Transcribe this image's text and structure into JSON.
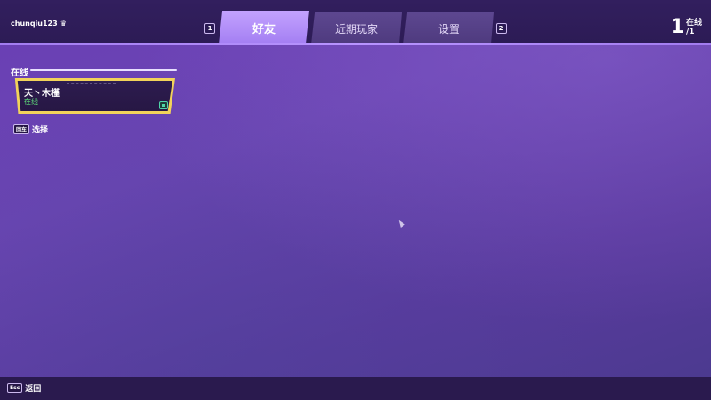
{
  "header": {
    "username": "chunqiu123",
    "crown_icon": "crown-icon",
    "left_key": "1",
    "right_key": "2",
    "tabs": [
      {
        "label": "好友",
        "active": true
      },
      {
        "label": "近期玩家",
        "active": false
      },
      {
        "label": "设置",
        "active": false
      }
    ],
    "online_count": "1",
    "online_label": "在线",
    "online_total": "/1"
  },
  "section": {
    "title": "在线"
  },
  "friend": {
    "name": "天丶木槿",
    "status": "在线",
    "platform_icon": "platform-icon"
  },
  "hints": {
    "select_key": "回车",
    "select_label": "选择",
    "back_key": "Esc",
    "back_label": "返回"
  },
  "colors": {
    "accent": "#a37ef2",
    "card_border": "#f2d35a",
    "status_online": "#5fe07a"
  }
}
